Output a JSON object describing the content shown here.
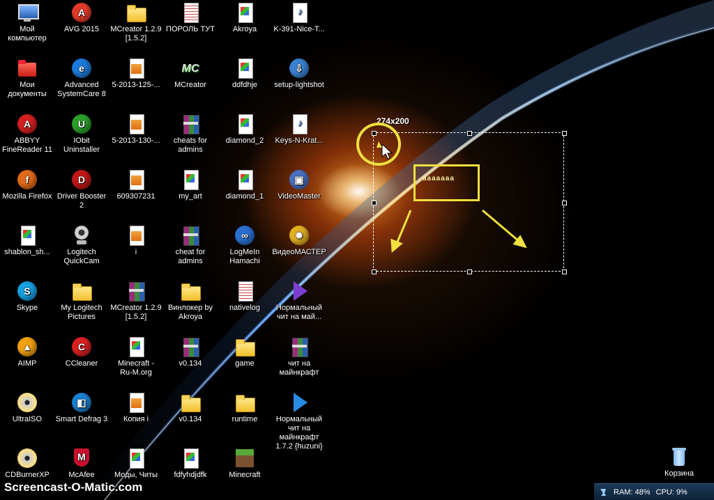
{
  "desktop": {
    "icons": [
      {
        "label": "Мой\nкомпьютер",
        "icon": "monitor-icon"
      },
      {
        "label": "AVG 2015",
        "icon": "avg-icon"
      },
      {
        "label": "MCreator 1.2.9\n[1.5.2]",
        "icon": "folder-icon"
      },
      {
        "label": "ПОРОЛЬ ТУТ",
        "icon": "text-document-icon"
      },
      {
        "label": "Akroya",
        "icon": "image-document-icon"
      },
      {
        "label": "K-391-Nice-T...",
        "icon": "mp3-icon"
      },
      {
        "label": "Мои\nдокументы",
        "icon": "documents-folder-icon"
      },
      {
        "label": "Advanced\nSystemCare 8",
        "icon": "systemcare-icon"
      },
      {
        "label": "5-2013-125-...",
        "icon": "archive-icon"
      },
      {
        "label": "MCreator",
        "icon": "mcreator-icon"
      },
      {
        "label": "ddfdhje",
        "icon": "image-document-icon"
      },
      {
        "label": "setup-lightshot",
        "icon": "setup-icon"
      },
      {
        "label": "ABBYY\nFineReader 11",
        "icon": "abbyy-icon"
      },
      {
        "label": "IObit\nUninstaller",
        "icon": "iobit-icon"
      },
      {
        "label": "5-2013-130-...",
        "icon": "archive-icon"
      },
      {
        "label": "cheats for\nadmins",
        "icon": "rar-icon"
      },
      {
        "label": "diamond_2",
        "icon": "image-document-icon"
      },
      {
        "label": "Keys-N-Krat...",
        "icon": "mp3-icon"
      },
      {
        "label": "Mozilla Firefox",
        "icon": "firefox-icon"
      },
      {
        "label": "Driver Booster\n2",
        "icon": "driver-booster-icon"
      },
      {
        "label": "609307231",
        "icon": "archive-icon"
      },
      {
        "label": "my_art",
        "icon": "image-document-icon"
      },
      {
        "label": "diamond_1",
        "icon": "image-document-icon"
      },
      {
        "label": "VideoMaster",
        "icon": "videomaster-icon"
      },
      {
        "label": "shablon_sh...",
        "icon": "image-document-icon"
      },
      {
        "label": "Logitech\nQuickCam",
        "icon": "webcam-icon"
      },
      {
        "label": "i",
        "icon": "archive-icon"
      },
      {
        "label": "cheat for\nadmins",
        "icon": "rar-icon"
      },
      {
        "label": "LogMeIn\nHamachi",
        "icon": "hamachi-icon"
      },
      {
        "label": "ВидеоМАСТЕР",
        "icon": "videomaster-gear-icon"
      },
      {
        "label": "Skype",
        "icon": "skype-icon"
      },
      {
        "label": "My Logitech\nPictures",
        "icon": "pictures-folder-icon"
      },
      {
        "label": "MCreator 1.2.9\n[1.5.2]",
        "icon": "rar-icon"
      },
      {
        "label": "Винлокер by\nAkroya",
        "icon": "folder-icon"
      },
      {
        "label": "nativelog",
        "icon": "text-document-icon"
      },
      {
        "label": "Нормальный\nчит на май...",
        "icon": "mp4-video-icon"
      },
      {
        "label": "AIMP",
        "icon": "aimp-icon"
      },
      {
        "label": "CCleaner",
        "icon": "ccleaner-icon"
      },
      {
        "label": "Minecraft -\nRu-M.org",
        "icon": "document-icon"
      },
      {
        "label": "v0.134",
        "icon": "rar-icon"
      },
      {
        "label": "game",
        "icon": "folder-icon"
      },
      {
        "label": "чит на\nмайнкрафт",
        "icon": "rar-icon"
      },
      {
        "label": "UltraISO",
        "icon": "cd-icon"
      },
      {
        "label": "Smart Defrag 3",
        "icon": "smart-defrag-icon"
      },
      {
        "label": "Копия i",
        "icon": "archive-icon"
      },
      {
        "label": "v0.134",
        "icon": "folder-icon"
      },
      {
        "label": "runtime",
        "icon": "folder-icon"
      },
      {
        "label": "Нормальный\nчит на\nмайнкрафт\n1.7.2 {huzuni}",
        "icon": "avi-video-icon"
      },
      {
        "label": "CDBurnerXP",
        "icon": "cdburner-icon"
      },
      {
        "label": "McAfee",
        "icon": "mcafee-icon"
      },
      {
        "label": "Моды, Читы",
        "icon": "document-icon"
      },
      {
        "label": "fdfyhdjdfk",
        "icon": "image-document-icon"
      },
      {
        "label": "Minecraft",
        "icon": "minecraft-icon"
      }
    ],
    "recycle_bin": {
      "label": "Корзина",
      "icon": "recycle-bin-icon"
    }
  },
  "capture": {
    "size_label": "274x200",
    "annotation_text": "ааааааа",
    "annotation_color": "#f0e040"
  },
  "tray": {
    "ram_label": "RAM: 48%",
    "cpu_label": "CPU: 9%"
  },
  "watermark": "Screencast-O-Matic.com"
}
